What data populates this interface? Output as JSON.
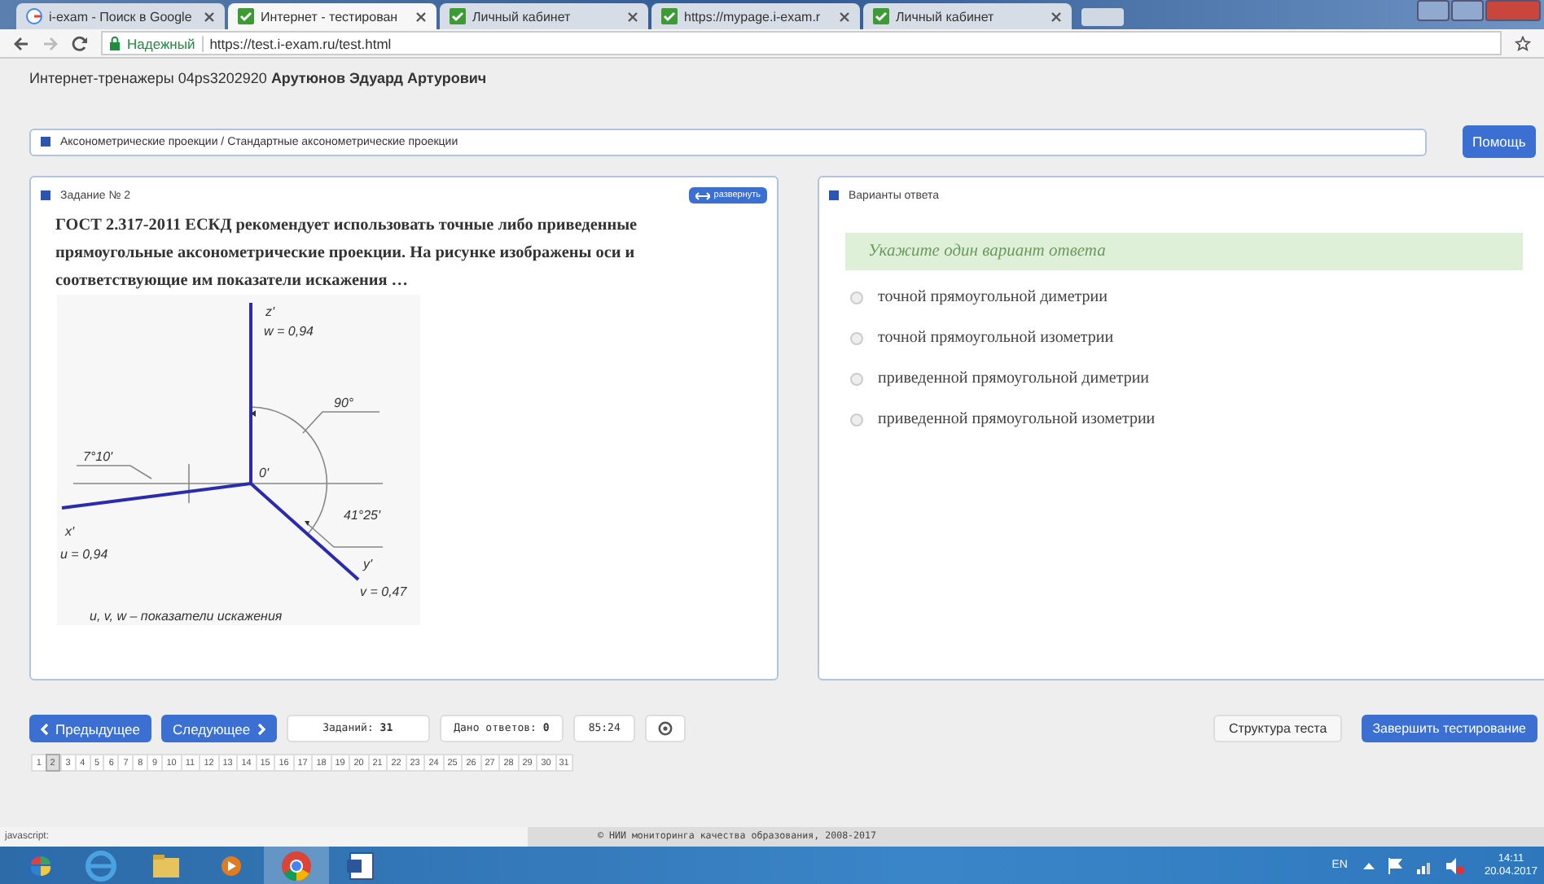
{
  "browser": {
    "tabs": [
      {
        "label": "i-exam - Поиск в Google",
        "kind": "google",
        "selected": false
      },
      {
        "label": "Интернет - тестирован",
        "kind": "site",
        "selected": true
      },
      {
        "label": "Личный кабинет",
        "kind": "site",
        "selected": false
      },
      {
        "label": "https://mypage.i-exam.r",
        "kind": "site",
        "selected": false
      },
      {
        "label": "Личный кабинет",
        "kind": "site",
        "selected": false
      }
    ],
    "address": {
      "security": "Надежный",
      "url": "https://test.i-exam.ru/test.html"
    }
  },
  "header": {
    "user": "Интернет-тренажеры 04ps3202920 **Арутюнов Эдуард Артурович**"
  },
  "breadcrumb": "Аксонометрические проекции / Стандартные аксонометрические проекции",
  "help_button": "Помощь",
  "task": {
    "title": "Задание № 2",
    "expand_button": "развернуть",
    "question": "ГОСТ 2.317-2011 ЕСКД рекомендует использовать точные либо приведенные прямоугольные аксонометрические проекции. На рисунке изображены оси и соответствующие им показатели искажения …",
    "figure_labels": [
      "z'",
      "w = 0,94",
      "90°",
      "0'",
      "7°10'",
      "41°25'",
      "x'",
      "u = 0,94",
      "y'",
      "v = 0,47",
      "u, v, w – показатели искажения"
    ]
  },
  "answers": {
    "title": "Варианты ответа",
    "hint": "Укажите один вариант ответа",
    "options": [
      {
        "label": "точной прямоугольной диметрии",
        "selected": false
      },
      {
        "label": "точной прямоугольной изометрии",
        "selected": false
      },
      {
        "label": "приведенной прямоугольной диметрии",
        "selected": false
      },
      {
        "label": "приведенной прямоугольной изометрии",
        "selected": false
      }
    ]
  },
  "nav": {
    "prev": "Предыдущее",
    "next": "Следующее",
    "tasks": "Заданий: **31**",
    "answered": "Дано ответов: **0**",
    "timer": "85:24",
    "structure": "Структура теста",
    "finish": "Завершить тестирование"
  },
  "pages": [
    {
      "label": "1",
      "selected": false
    },
    {
      "label": "2",
      "selected": true
    },
    {
      "label": "3",
      "selected": false
    },
    {
      "label": "4",
      "selected": false
    },
    {
      "label": "5",
      "selected": false
    },
    {
      "label": "6",
      "selected": false
    },
    {
      "label": "7",
      "selected": false
    },
    {
      "label": "8",
      "selected": false
    },
    {
      "label": "9",
      "selected": false
    },
    {
      "label": "10",
      "selected": false
    },
    {
      "label": "11",
      "selected": false
    },
    {
      "label": "12",
      "selected": false
    },
    {
      "label": "13",
      "selected": false
    },
    {
      "label": "14",
      "selected": false
    },
    {
      "label": "15",
      "selected": false
    },
    {
      "label": "16",
      "selected": false
    },
    {
      "label": "17",
      "selected": false
    },
    {
      "label": "18",
      "selected": false
    },
    {
      "label": "19",
      "selected": false
    },
    {
      "label": "20",
      "selected": false
    },
    {
      "label": "21",
      "selected": false
    },
    {
      "label": "22",
      "selected": false
    },
    {
      "label": "23",
      "selected": false
    },
    {
      "label": "24",
      "selected": false
    },
    {
      "label": "25",
      "selected": false
    },
    {
      "label": "26",
      "selected": false
    },
    {
      "label": "27",
      "selected": false
    },
    {
      "label": "28",
      "selected": false
    },
    {
      "label": "29",
      "selected": false
    },
    {
      "label": "30",
      "selected": false
    },
    {
      "label": "31",
      "selected": false
    }
  ],
  "status_bar": {
    "link": "javascript:",
    "copyright": "© НИИ мониторинга качества образования, 2008-2017"
  },
  "taskbar": {
    "language": "EN",
    "time": "14:11",
    "date": "20.04.2017"
  }
}
